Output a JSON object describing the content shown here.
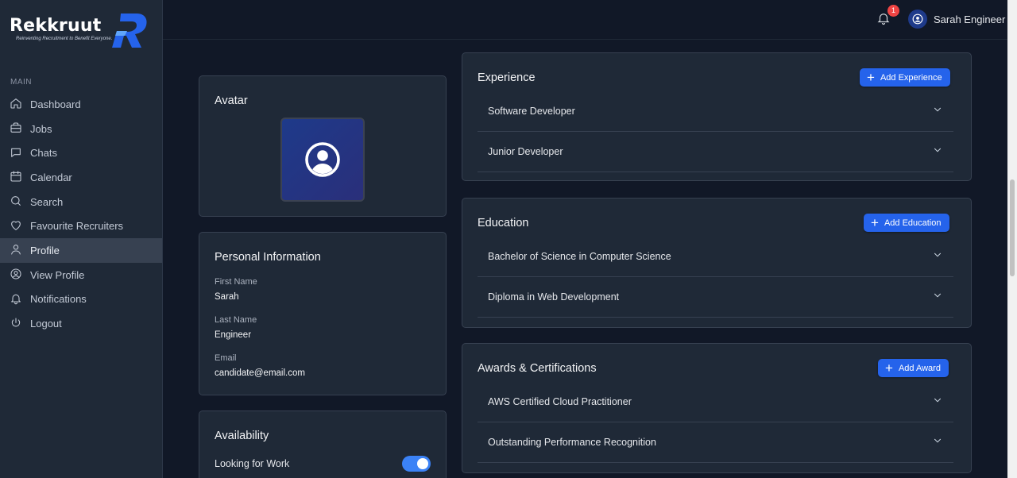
{
  "brand": {
    "name": "Rekkruut",
    "tagline": "Reinventing Recruitment to Benefit Everyone."
  },
  "sidebar": {
    "section": "MAIN",
    "items": [
      {
        "label": "Dashboard",
        "icon": "home-icon"
      },
      {
        "label": "Jobs",
        "icon": "briefcase-icon"
      },
      {
        "label": "Chats",
        "icon": "chat-icon"
      },
      {
        "label": "Calendar",
        "icon": "calendar-icon"
      },
      {
        "label": "Search",
        "icon": "search-icon"
      },
      {
        "label": "Favourite Recruiters",
        "icon": "heart-icon"
      },
      {
        "label": "Profile",
        "icon": "user-icon",
        "active": true
      },
      {
        "label": "View Profile",
        "icon": "user-circle-icon"
      },
      {
        "label": "Notifications",
        "icon": "bell-icon"
      },
      {
        "label": "Logout",
        "icon": "power-icon"
      }
    ]
  },
  "topbar": {
    "notification_count": "1",
    "user_name": "Sarah Engineer"
  },
  "avatar_card": {
    "title": "Avatar"
  },
  "personal": {
    "title": "Personal Information",
    "first_name_label": "First Name",
    "first_name": "Sarah",
    "last_name_label": "Last Name",
    "last_name": "Engineer",
    "email_label": "Email",
    "email": "candidate@email.com"
  },
  "availability": {
    "title": "Availability",
    "looking_label": "Looking for Work",
    "looking": true
  },
  "experience": {
    "title": "Experience",
    "add_label": "Add Experience",
    "items": [
      "Software Developer",
      "Junior Developer"
    ]
  },
  "education": {
    "title": "Education",
    "add_label": "Add Education",
    "items": [
      "Bachelor of Science in Computer Science",
      "Diploma in Web Development"
    ]
  },
  "awards": {
    "title": "Awards & Certifications",
    "add_label": "Add Award",
    "items": [
      "AWS Certified Cloud Practitioner",
      "Outstanding Performance Recognition"
    ]
  },
  "colors": {
    "accent": "#2563eb",
    "background": "#111827",
    "card": "#1f2937",
    "badge": "#ef4444"
  }
}
